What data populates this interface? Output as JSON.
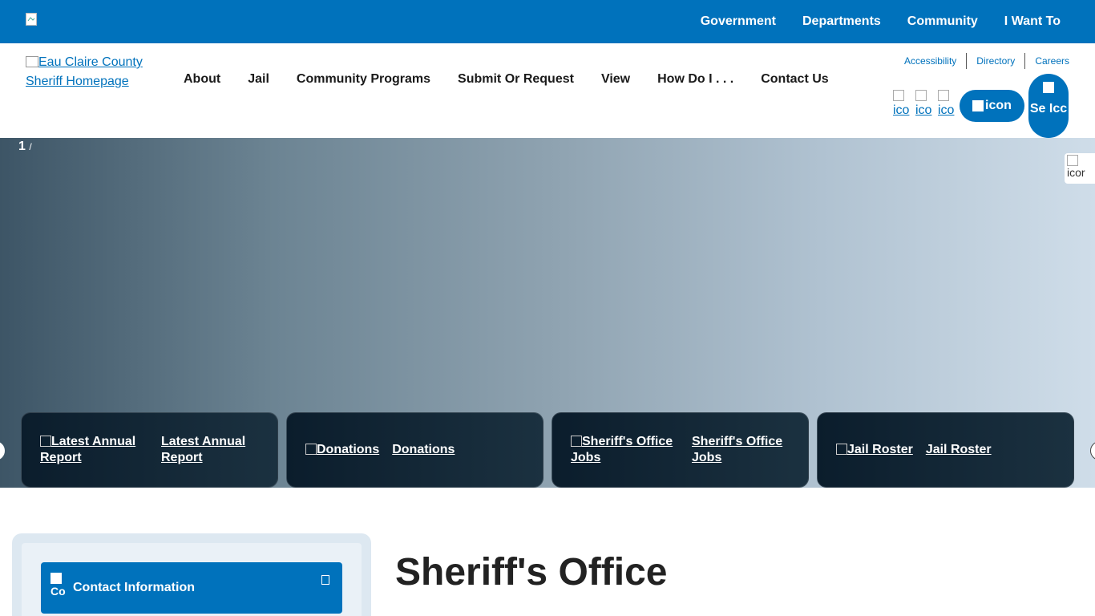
{
  "topbar": {
    "logo_alt": "",
    "nav": [
      "Government",
      "Departments",
      "Community",
      "I Want To"
    ]
  },
  "header": {
    "logo_alt": "Eau Claire County Sheriff Homepage",
    "nav": [
      "About",
      "Jail",
      "Community Programs",
      "Submit Or Request",
      "View",
      "How Do I . . .",
      "Contact Us"
    ],
    "utility": [
      "Accessibility",
      "Directory",
      "Careers"
    ],
    "icon_links": [
      "ico",
      "ico",
      "ico"
    ],
    "pill_button": "icon",
    "search_button": "Se Icc"
  },
  "hero": {
    "slide_counter": "1",
    "slide_separator": "/",
    "side_widget": "icor",
    "cards": [
      {
        "img_alt": "Latest Annual Report",
        "label": "Latest Annual Report"
      },
      {
        "img_alt": "Donations",
        "label": "Donations"
      },
      {
        "img_alt": "Sheriff's Office Jobs",
        "label": "Sheriff's Office Jobs"
      },
      {
        "img_alt": "Jail Roster",
        "label": "Jail Roster"
      }
    ]
  },
  "sidebar": {
    "contact_icon_alt": "Co",
    "contact_label": "Contact Information"
  },
  "main": {
    "title": "Sheriff's Office"
  },
  "colors": {
    "brand_blue": "#0072bc",
    "card_dark": "#0b1d2c"
  }
}
